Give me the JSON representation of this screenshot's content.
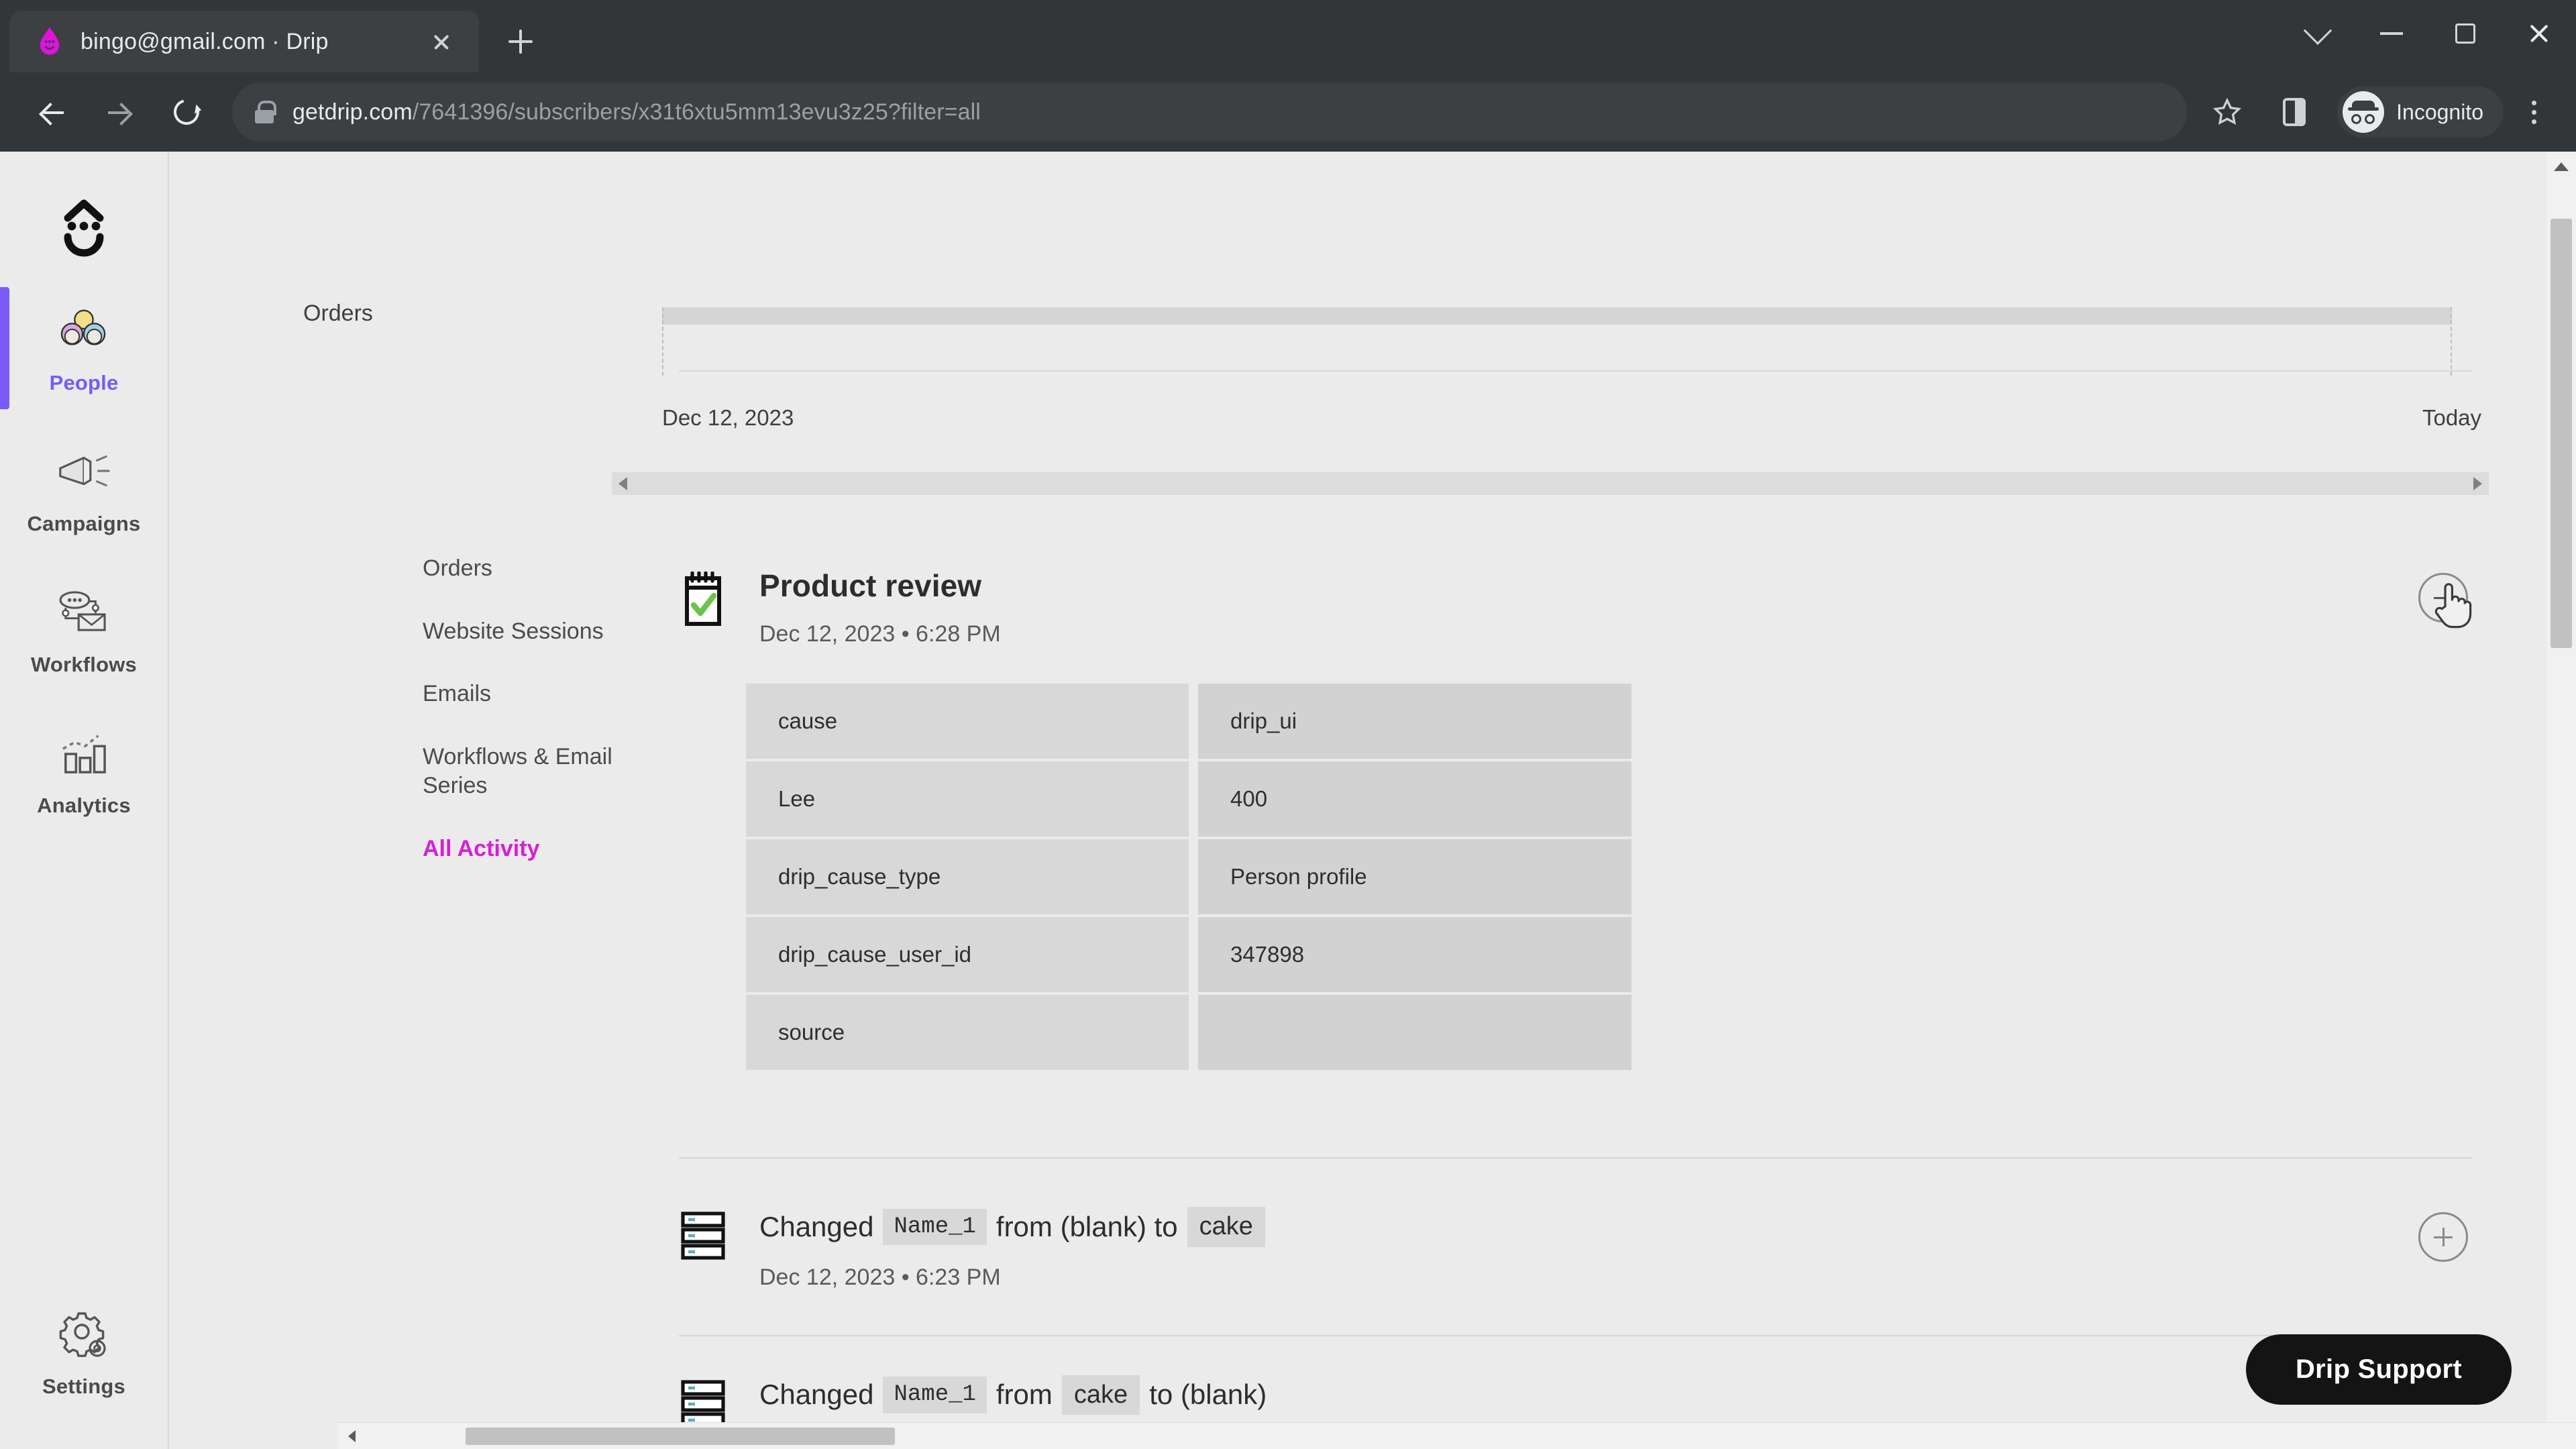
{
  "browser": {
    "tab": {
      "title": "bingo@gmail.com · Drip",
      "favicon_icon": "drip-logo-icon",
      "close_icon": "close-icon"
    },
    "new_tab_icon": "plus-icon",
    "window_controls": [
      {
        "name": "tab-search",
        "icon": "chevron-down-icon"
      },
      {
        "name": "minimize",
        "icon": "minimize-icon"
      },
      {
        "name": "maximize",
        "icon": "maximize-icon"
      },
      {
        "name": "close",
        "icon": "close-icon"
      }
    ],
    "nav": {
      "back_icon": "back-arrow-icon",
      "forward_icon": "forward-arrow-icon",
      "reload_icon": "reload-icon"
    },
    "omnibox": {
      "lock_icon": "lock-icon",
      "url_domain": "getdrip.com",
      "url_path": "/7641396/subscribers/x31t6xtu5mm13evu3z25?filter=all"
    },
    "toolbar_right": {
      "bookmark_icon": "star-icon",
      "side_panel_icon": "side-panel-icon",
      "profile_icon": "incognito-icon",
      "profile_label": "Incognito",
      "menu_icon": "kebab-menu-icon"
    }
  },
  "rail": {
    "logo_icon": "drip-face-logo-icon",
    "items": [
      {
        "label": "People",
        "icon": "people-icon",
        "active": true
      },
      {
        "label": "Campaigns",
        "icon": "megaphone-icon",
        "active": false
      },
      {
        "label": "Workflows",
        "icon": "workflow-icon",
        "active": false
      },
      {
        "label": "Analytics",
        "icon": "bar-chart-icon",
        "active": false
      }
    ],
    "bottom": {
      "label": "Settings",
      "icon": "gear-icon"
    }
  },
  "subnav": {
    "items": [
      {
        "label": "Orders",
        "active": false
      },
      {
        "label": "Website Sessions",
        "active": false
      },
      {
        "label": "Emails",
        "active": false
      },
      {
        "label": "Workflows & Email Series",
        "active": false
      },
      {
        "label": "All Activity",
        "active": true
      }
    ]
  },
  "timeline": {
    "row_label": "Orders",
    "start_date": "Dec 12, 2023",
    "end_date": "Today",
    "scroll_left_icon": "scroll-left-arrow-icon",
    "scroll_right_icon": "scroll-right-arrow-icon"
  },
  "feed": {
    "entries": [
      {
        "id": "product-review",
        "icon": "notepad-check-icon",
        "title": "Product review",
        "timestamp": "Dec 12, 2023 • 6:28 PM",
        "toggle_icon": "collapse-circle-icon",
        "cursor_icon": "hand-pointer-cursor-icon",
        "properties": [
          {
            "key": "cause",
            "value": "drip_ui"
          },
          {
            "key": "Lee",
            "value": "400"
          },
          {
            "key": "drip_cause_type",
            "value": "Person profile"
          },
          {
            "key": "drip_cause_user_id",
            "value": "347898"
          },
          {
            "key": "source",
            "value": ""
          }
        ]
      },
      {
        "id": "changed-name-to-cake",
        "icon": "records-stack-icon",
        "prefix": "Changed",
        "field": "Name_1",
        "middle": "from",
        "from_value": "(blank)",
        "connector": "to",
        "to_value": "cake",
        "timestamp": "Dec 12, 2023 • 6:23 PM",
        "toggle_icon": "expand-circle-icon"
      },
      {
        "id": "changed-name-to-blank",
        "icon": "records-stack-icon",
        "prefix": "Changed",
        "field": "Name_1",
        "middle": "from",
        "from_value": "cake",
        "connector": "to",
        "to_value": "(blank)",
        "timestamp": "",
        "toggle_icon": "expand-circle-icon"
      }
    ]
  },
  "support": {
    "label": "Drip Support"
  },
  "colors": {
    "accent_purple": "#7a5af8",
    "accent_magenta": "#d81ed8",
    "page_bg": "#ebebeb",
    "chrome_bg": "#323639",
    "support_bg": "#141414"
  }
}
